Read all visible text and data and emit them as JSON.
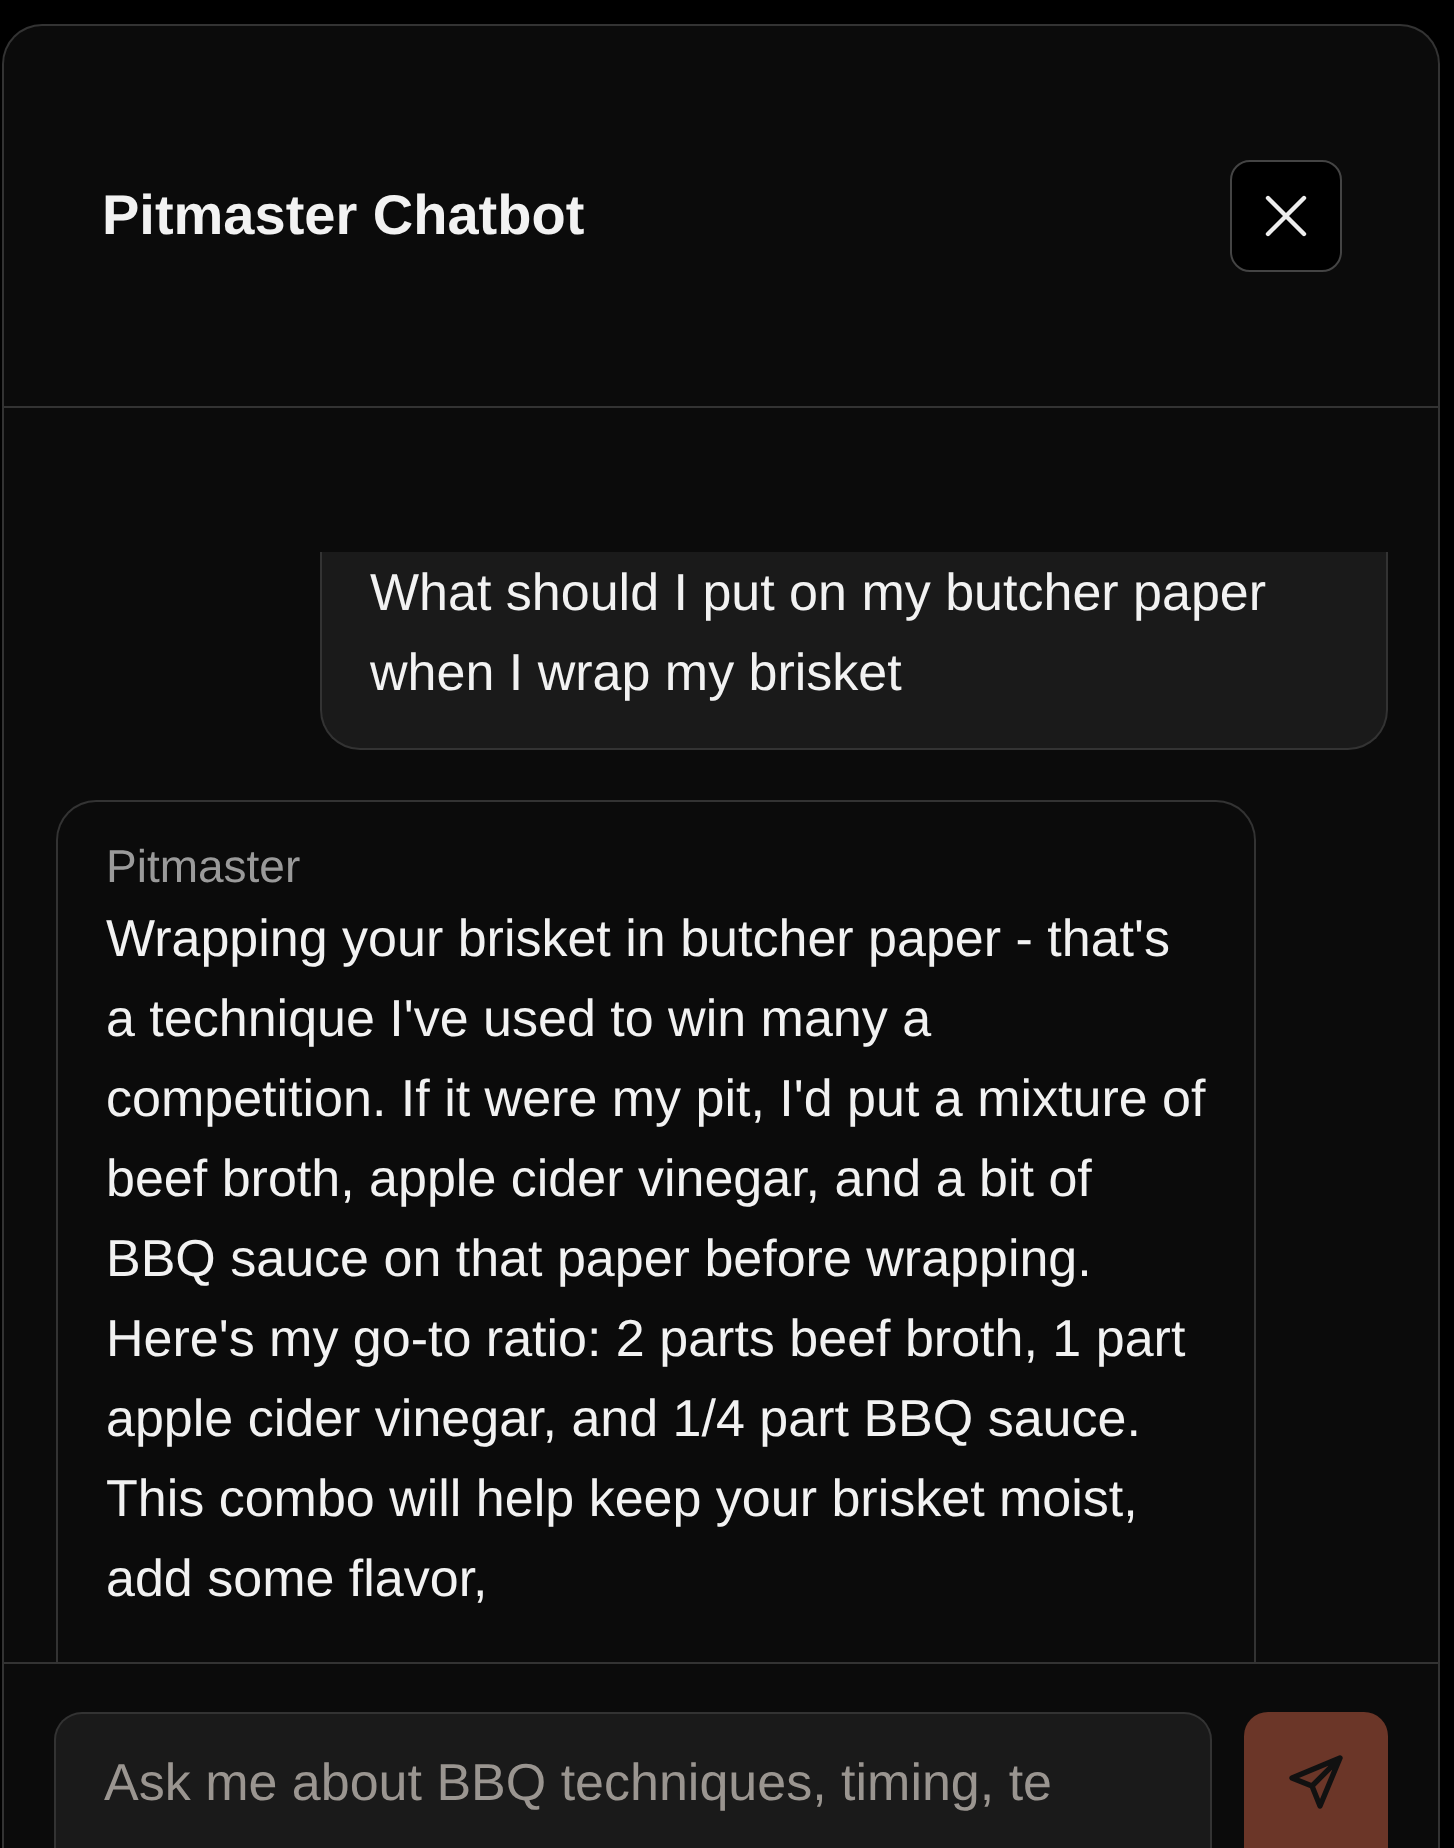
{
  "window": {
    "title": "Pitmaster Chatbot"
  },
  "messages": [
    {
      "kind": "user",
      "text": "What should I put on my butcher paper when I wrap my brisket"
    },
    {
      "kind": "bot",
      "sender": "Pitmaster",
      "text": "Wrapping your brisket in butcher paper - that's a technique I've used to win many a competition. If it were my pit, I'd put a mixture of beef broth, apple cider vinegar, and a bit of BBQ sauce on that paper before wrapping. Here's my go-to ratio: 2 parts beef broth, 1 part apple cider vinegar, and 1/4 part BBQ sauce. This combo will help keep your brisket moist, add some flavor,"
    }
  ],
  "input": {
    "placeholder": "Ask me about BBQ techniques, timing, te"
  }
}
